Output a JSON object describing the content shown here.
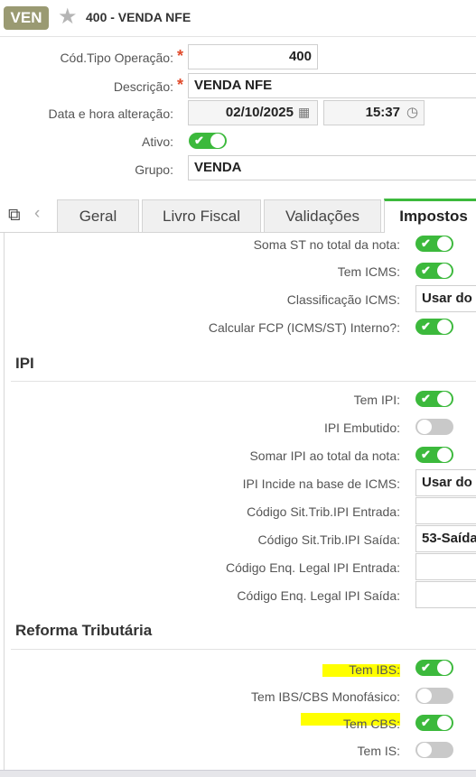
{
  "header": {
    "badge": "VEN",
    "title": "400 - VENDA NFE"
  },
  "form": {
    "cod_label": "Cód.Tipo Operação:",
    "cod_value": "400",
    "desc_label": "Descrição:",
    "desc_value": "VENDA NFE",
    "data_label": "Data e hora alteração:",
    "date_value": "02/10/2025",
    "time_value": "15:37",
    "ativo_label": "Ativo:",
    "ativo": true,
    "grupo_label": "Grupo:",
    "grupo_value": "VENDA"
  },
  "tabs": [
    {
      "label": "Geral",
      "active": false
    },
    {
      "label": "Livro Fiscal",
      "active": false
    },
    {
      "label": "Validações",
      "active": false
    },
    {
      "label": "Impostos",
      "active": true
    }
  ],
  "impostos": {
    "rows_top": [
      {
        "label": "Soma ST no total da nota:",
        "type": "toggle",
        "on": true
      },
      {
        "label": "Tem ICMS:",
        "type": "toggle",
        "on": true
      },
      {
        "label": "Classificação ICMS:",
        "type": "select",
        "value": "Usar do"
      },
      {
        "label": "Calcular FCP (ICMS/ST) Interno?:",
        "type": "toggle",
        "on": true
      }
    ],
    "ipi_title": "IPI",
    "ipi_rows": [
      {
        "label": "Tem IPI:",
        "type": "toggle",
        "on": true
      },
      {
        "label": "IPI Embutido:",
        "type": "toggle",
        "on": false
      },
      {
        "label": "Somar IPI ao total da nota:",
        "type": "toggle",
        "on": true
      },
      {
        "label": "IPI Incide na base de ICMS:",
        "type": "select",
        "value": "Usar do"
      },
      {
        "label": "Código Sit.Trib.IPI Entrada:",
        "type": "select",
        "value": ""
      },
      {
        "label": "Código Sit.Trib.IPI Saída:",
        "type": "select",
        "value": "53-Saída"
      },
      {
        "label": "Código Enq. Legal IPI Entrada:",
        "type": "select",
        "value": ""
      },
      {
        "label": "Código Enq. Legal IPI Saída:",
        "type": "select",
        "value": ""
      }
    ],
    "reforma_title": "Reforma Tributária",
    "reforma_rows": [
      {
        "label": "Tem IBS:",
        "type": "toggle",
        "on": true
      },
      {
        "label": "Tem IBS/CBS Monofásico:",
        "type": "toggle",
        "on": false
      },
      {
        "label": "Tem CBS:",
        "type": "toggle",
        "on": true
      },
      {
        "label": "Tem IS:",
        "type": "toggle",
        "on": false
      }
    ]
  },
  "colors": {
    "toggle_on": "#3cb93c",
    "toggle_off": "#c9c9c9",
    "highlight": "#ffff00",
    "badge": "#9a9a72",
    "required": "#e04b2c"
  }
}
